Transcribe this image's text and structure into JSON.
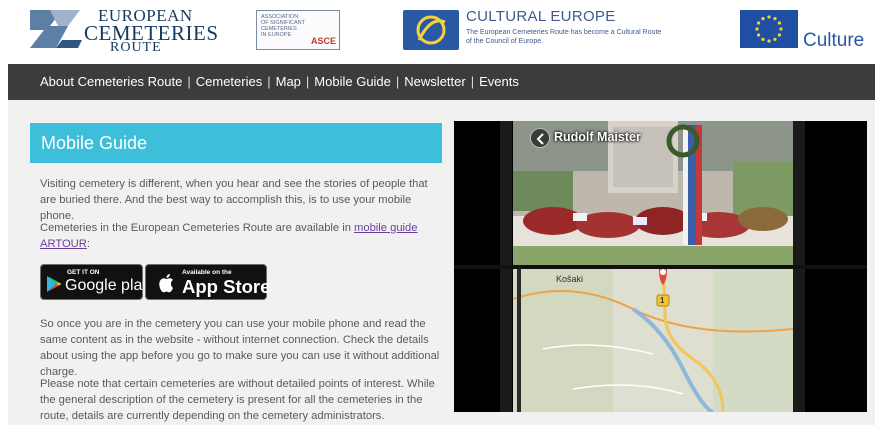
{
  "header": {
    "ecr_logo": {
      "line1": "EUROPEAN",
      "line2": "CEMETERIES",
      "line3": "ROUTE"
    },
    "asce_logo": {
      "line1": "ASSOCIATION",
      "line2": "OF SIGNIFICANT",
      "line3": "CEMETERIES",
      "line4": "IN EUROPE",
      "mark": "ASCE"
    },
    "cultural_europe": {
      "title": "CULTURAL EUROPE",
      "subtitle": "The European Cemeteries Route has become a Cultural Route of the Council of Europe."
    },
    "culture_label": "Culture"
  },
  "nav": {
    "items": [
      {
        "label": "About Cemeteries Route"
      },
      {
        "label": "Cemeteries"
      },
      {
        "label": "Map"
      },
      {
        "label": "Mobile Guide"
      },
      {
        "label": "Newsletter"
      },
      {
        "label": "Events"
      }
    ],
    "separator": "|"
  },
  "main": {
    "title": "Mobile Guide",
    "p1": "Visiting cemetery is different, when you hear and see the stories of people that are buried there. And the best way to accomplish this, is to use your mobile phone.",
    "p2_text": "Cemeteries in the European Cemeteries Route are available in ",
    "p2_link": "mobile guide ARTOUR",
    "p2_end": ":",
    "badges": {
      "google": {
        "small": "GET IT ON",
        "big": "Google play"
      },
      "apple": {
        "small": "Available on the",
        "big": "App Store"
      }
    },
    "p3": "So once you are in the cemetery you can use your mobile phone and read the same content as in the website - without internet connection. Check the details about using the app before you go to make sure you can use it without additional charge.",
    "p4": "Please note that certain cemeteries are without detailed points of interest. While the general description of the cemetery is present for all the cemeteries in the route, details are currently depending on the cemetery administrators."
  },
  "preview": {
    "photo_title": "Rudolf Maister",
    "map_label": "Košaki",
    "map_marker": "1"
  },
  "colors": {
    "nav_bg": "#3c3c3c",
    "title_bar": "#3dbfda",
    "link": "#6a3f9a",
    "content_bg": "#f1f1f1"
  }
}
